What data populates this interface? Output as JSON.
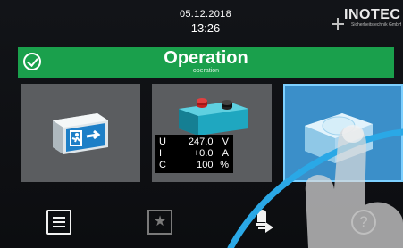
{
  "header": {
    "date": "05.12.2018",
    "time": "13:26",
    "logo_text": "INOTEC",
    "logo_subtitle": "Sicherheitstechnik GmbH"
  },
  "status": {
    "title": "Operation",
    "subtitle": "operation",
    "color": "#1aa04c",
    "icon": "check-circle-icon"
  },
  "tiles": [
    {
      "id": "emergency-lighting",
      "icon": "exit-sign-icon"
    },
    {
      "id": "battery",
      "icon": "battery-icon"
    },
    {
      "id": "device",
      "icon": "device-icon",
      "selected": true,
      "accent": "#3b8fc9"
    }
  ],
  "battery_readout": {
    "rows": [
      {
        "quantity": "U",
        "value": "247.0",
        "unit": "V"
      },
      {
        "quantity": "I",
        "value": "+0.0",
        "unit": "A"
      },
      {
        "quantity": "C",
        "value": "100",
        "unit": "%"
      }
    ]
  },
  "nav": {
    "items": [
      {
        "id": "menu",
        "icon": "menu-list-icon"
      },
      {
        "id": "favorites",
        "icon": "star-icon",
        "glyph": "★"
      },
      {
        "id": "function-test",
        "icon": "light-test-icon"
      },
      {
        "id": "help",
        "icon": "help-icon",
        "glyph": "?"
      }
    ]
  }
}
